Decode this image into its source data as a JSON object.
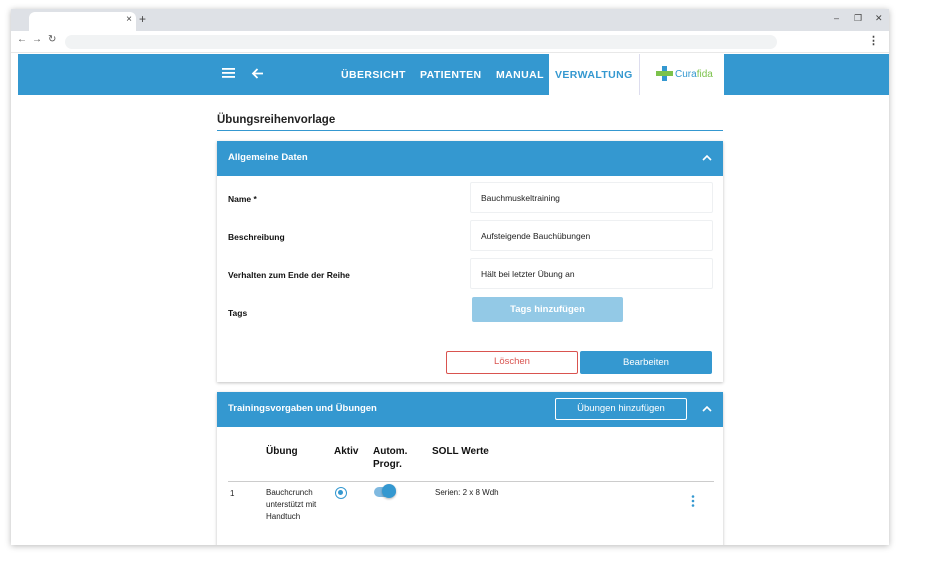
{
  "browser": {
    "tab_close": "×",
    "new_tab": "+",
    "minimize": "–",
    "restore": "❐",
    "close": "✕",
    "nav_back": "←",
    "nav_forward": "→",
    "reload": "↻",
    "menu": "⋮"
  },
  "header": {
    "nav": [
      "ÜBERSICHT",
      "PATIENTEN",
      "MANUAL",
      "VERWALTUNG"
    ],
    "active_nav": "VERWALTUNG",
    "logo_main": "Cura",
    "logo_accent": "fida",
    "accent_color": "#3498d0"
  },
  "page": {
    "title": "Übungsreihenvorlage"
  },
  "general": {
    "title": "Allgemeine Daten",
    "fields": [
      {
        "label": "Name *",
        "value": "Bauchmuskeltraining"
      },
      {
        "label": "Beschreibung",
        "value": "Aufsteigende Bauchübungen"
      },
      {
        "label": "Verhalten zum Ende der Reihe",
        "value": "Hält bei letzter Übung an"
      }
    ],
    "tags_label": "Tags",
    "tags_button": "Tags hinzufügen",
    "delete_button": "Löschen",
    "edit_button": "Bearbeiten"
  },
  "training": {
    "title": "Trainingsvorgaben und Übungen",
    "add_button": "Übungen hinzufügen",
    "columns": {
      "exercise": "Übung",
      "active": "Aktiv",
      "auto_line1": "Autom.",
      "auto_line2": "Progr.",
      "target": "SOLL Werte"
    },
    "rows": [
      {
        "index": "1",
        "name_line1": "Bauchcrunch",
        "name_line2": "unterstützt mit",
        "name_line3": "Handtuch",
        "target": "Serien: 2 x 8 Wdh"
      }
    ]
  }
}
